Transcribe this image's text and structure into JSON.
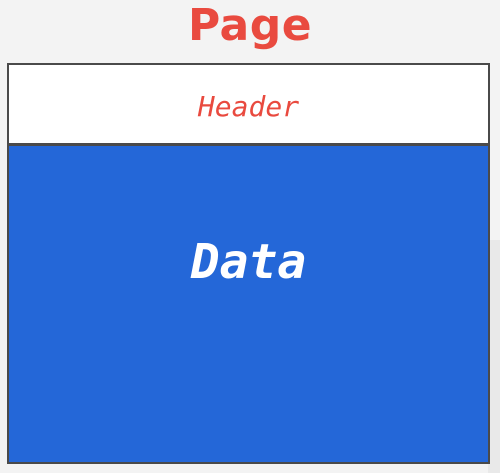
{
  "diagram": {
    "title": "Page",
    "sections": {
      "header": "Header",
      "data": "Data"
    }
  },
  "colors": {
    "title_text": "#e94a3f",
    "header_text": "#e94a3f",
    "header_fill": "#ffffff",
    "data_fill": "#2467d8",
    "data_text": "#ffffff",
    "border": "#4a4a4a",
    "background": "#f3f3f3"
  }
}
